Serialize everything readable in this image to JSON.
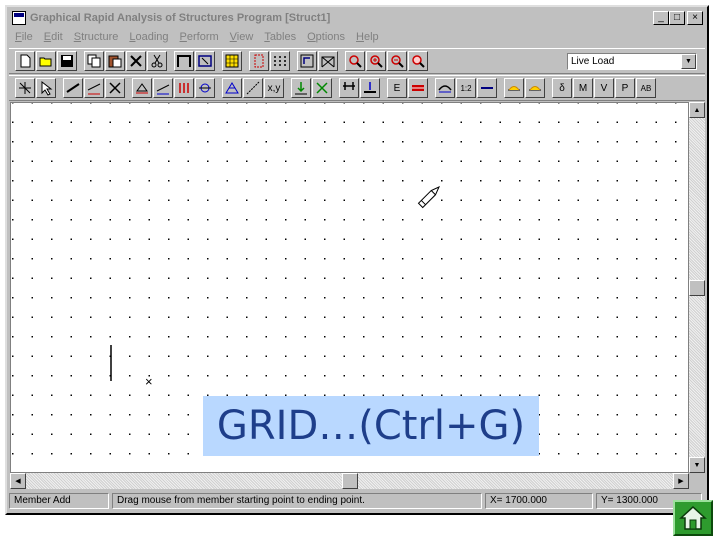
{
  "window": {
    "title": "Graphical Rapid Analysis of Structures Program [Struct1]",
    "controls": {
      "minimize": "_",
      "maximize": "□",
      "close": "×"
    }
  },
  "menu": [
    "File",
    "Edit",
    "Structure",
    "Loading",
    "Perform",
    "View",
    "Tables",
    "Options",
    "Help"
  ],
  "toolbar": {
    "load_case": "Live Load",
    "row2_labels": {
      "coords": "x,y",
      "e_btn": "E",
      "span": "1:2",
      "d_btn": "δ",
      "m_btn": "M",
      "v_btn": "V",
      "p_btn": "P",
      "ab_btn": "AB"
    }
  },
  "canvas": {
    "cursor_mark": "×"
  },
  "overlay": {
    "caption": "GRID…(Ctrl+G)"
  },
  "status": {
    "mode": "Member Add",
    "hint": "Drag mouse from member starting point to ending point.",
    "x": "X= 1700.000",
    "y": "Y= 1300.000"
  },
  "colors": {
    "caption_bg": "#b9d8ff",
    "caption_text": "#1e3e8a",
    "home_button": "#2e9b2e"
  },
  "icons": [
    "home-icon",
    "pencil-cursor-icon"
  ]
}
